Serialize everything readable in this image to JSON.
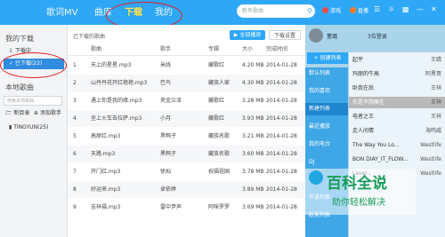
{
  "top": {
    "tabs": [
      "歌词MV",
      "曲库",
      "下载",
      "我的"
    ],
    "active_tab": "下载",
    "search_placeholder": "新年歌曲",
    "game_label": "游戏",
    "live_label": "直播",
    "window_icons": [
      "menu-icon",
      "skin-icon",
      "mini-icon",
      "minimize-icon",
      "close-icon"
    ]
  },
  "sidebar": {
    "my_downloads_title": "我的下载",
    "downloading": "下载中",
    "downloaded": "已下载(22)",
    "local_title": "本地歌曲",
    "search_placeholder": "搜索本地歌曲",
    "new_folder": "新目录",
    "add_song": "添加歌手",
    "folder_label": "TINGYUN(25)"
  },
  "main": {
    "header_label": "已下载的歌曲",
    "play_all": "全部播放",
    "settings": "下载设置",
    "columns": [
      "歌曲",
      "歌手",
      "专辑",
      "大小",
      "完成时间"
    ],
    "rows": [
      {
        "n": "1",
        "title": "天上的星星.mp3",
        "artist": "米线",
        "album": "藏歌红",
        "size": "4.20 MB",
        "date": "2014-01-28"
      },
      {
        "n": "2",
        "title": "山丹丹花开红艳艳.mp3",
        "artist": "巴鸟",
        "album": "藏族人家",
        "size": "4.30 MB",
        "date": "2014-01-28"
      },
      {
        "n": "3",
        "title": "遇上你是我的缘.mp3",
        "artist": "央金兰泽",
        "album": "藏歌红",
        "size": "3.28 MB",
        "date": "2014-01-28"
      },
      {
        "n": "4",
        "title": "坐上火车去拉萨.mp3",
        "artist": "小月",
        "album": "藏歌红",
        "size": "3.93 MB",
        "date": "2014-01-28"
      },
      {
        "n": "5",
        "title": "高原红.mp3",
        "artist": "黑鸭子",
        "album": "藏族名歌",
        "size": "3.21 MB",
        "date": "2014-01-28"
      },
      {
        "n": "6",
        "title": "天路.mp3",
        "artist": "黑鸭子",
        "album": "藏族名歌",
        "size": "3.60 MB",
        "date": "2014-01-28"
      },
      {
        "n": "7",
        "title": "开门红.mp3",
        "artist": "徐灿",
        "album": "祝福祖国",
        "size": "3.78 MB",
        "date": "2014-01-28"
      },
      {
        "n": "8",
        "title": "好运来.mp3",
        "artist": "卓依婷",
        "album": "",
        "size": "3.89 MB",
        "date": "2014-01-28"
      },
      {
        "n": "9",
        "title": "吉祥福.mp3",
        "artist": "雷中尹声",
        "album": "阿咪罗罗",
        "size": "3.69 MB",
        "date": "2014-01-28"
      }
    ]
  },
  "right": {
    "user": "董璐",
    "login": "3位登录",
    "create": "+ 创建列表",
    "nav": [
      "默认列表",
      "我的喜欢",
      "新建列表",
      "最近播放",
      "我的电台",
      "DJ",
      "好听",
      "华语列表",
      "欧美列表"
    ],
    "items": [
      {
        "t": "起平",
        "s": "王婧"
      },
      {
        "t": "玛丽的牛高",
        "s": "阿黑哥"
      },
      {
        "t": "卧我在后",
        "s": "王祥"
      },
      {
        "t": "你是不想嘛在",
        "s": "王祥"
      },
      {
        "t": "电者之王",
        "s": "王祥"
      },
      {
        "t": "走人间情",
        "s": "海鸣威"
      },
      {
        "t": "The Way You Lo...",
        "s": "Westlife"
      },
      {
        "t": "BON DIAY_IT_FLOW...",
        "s": "Westlife"
      },
      {
        "t": "Lavel...",
        "s": "Westlife"
      }
    ]
  },
  "watermark": {
    "title": "百科全说",
    "subtitle": "助你轻松解决"
  },
  "colors": {
    "accent": "#2ea7f6",
    "active_tab": "#ffe04a",
    "highlight": "#e02020"
  }
}
